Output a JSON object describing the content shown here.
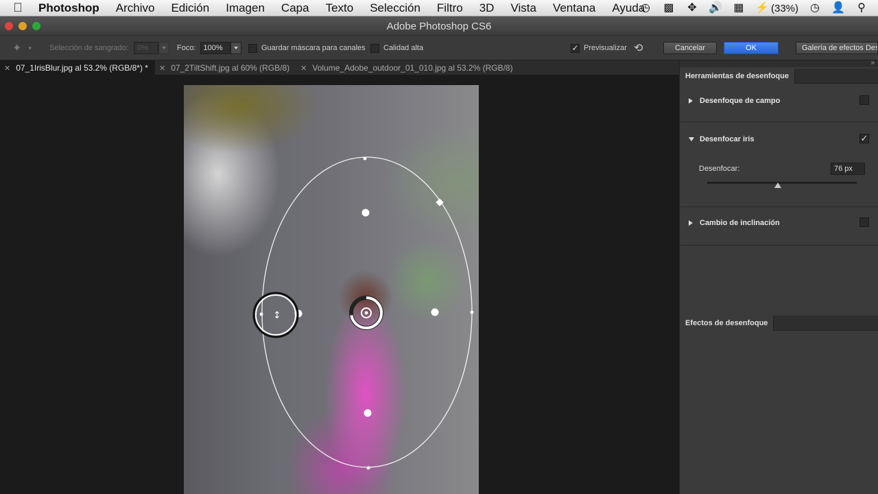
{
  "menubar": {
    "app_name": "Photoshop",
    "items": [
      "Archivo",
      "Edición",
      "Imagen",
      "Capa",
      "Texto",
      "Selección",
      "Filtro",
      "3D",
      "Vista",
      "Ventana",
      "Ayuda"
    ],
    "battery": "(33%)"
  },
  "window": {
    "title": "Adobe Photoshop CS6"
  },
  "options": {
    "bleed_label": "Selección de sangrado:",
    "bleed_value": "0%",
    "focus_label": "Foco:",
    "focus_value": "100%",
    "save_mask_label": "Guardar máscara para canales",
    "high_quality_label": "Calidad alta",
    "preview_label": "Previsualizar",
    "cancel_label": "Cancelar",
    "ok_label": "OK",
    "gallery_label": "Galería de efectos Des"
  },
  "tabs": [
    {
      "label": "07_1IrisBlur.jpg al 53.2% (RGB/8*) *",
      "active": true
    },
    {
      "label": "07_2TiltShift.jpg al 60% (RGB/8)",
      "active": false
    },
    {
      "label": "Volume_Adobe_outdoor_01_010.jpg al 53.2% (RGB/8)",
      "active": false
    }
  ],
  "panel": {
    "title": "Herramientas de desenfoque",
    "field_blur_label": "Desenfoque de campo",
    "iris_blur_label": "Desenfocar iris",
    "blur_label": "Desenfocar:",
    "blur_value": "76 px",
    "tilt_shift_label": "Cambio de inclinación",
    "effects_title": "Efectos de desenfoque"
  },
  "colors": {
    "accent": "#2a66d2",
    "panel_bg": "#3b3b3b",
    "canvas_bg": "#1b1b1b"
  }
}
